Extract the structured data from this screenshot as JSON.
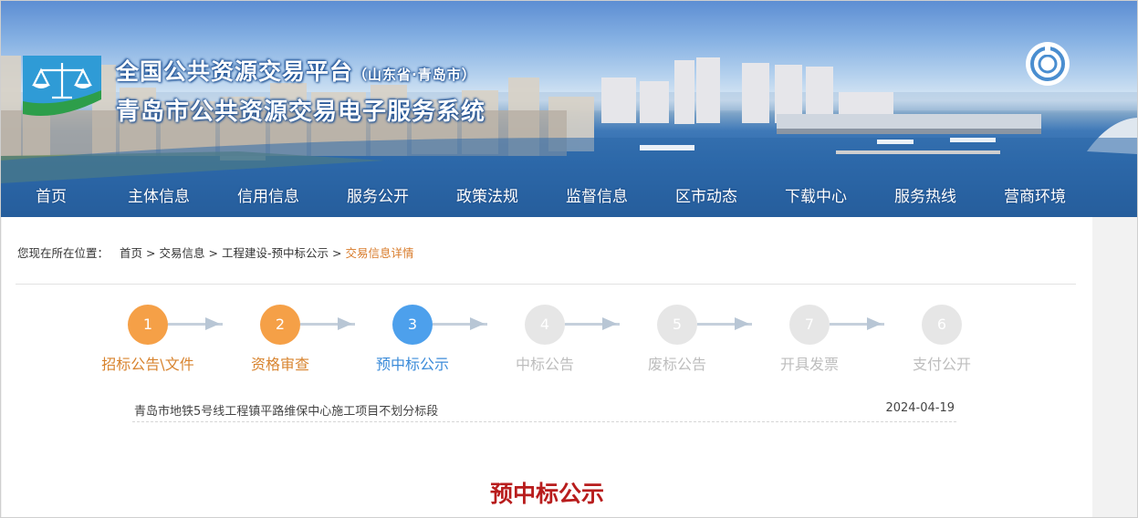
{
  "header": {
    "title_main": "全国公共资源交易平台",
    "title_sub": "（山东省·青岛市）",
    "title_system": "青岛市公共资源交易电子服务系统"
  },
  "nav": [
    "首页",
    "主体信息",
    "信用信息",
    "服务公开",
    "政策法规",
    "监督信息",
    "区市动态",
    "下载中心",
    "服务热线",
    "营商环境"
  ],
  "breadcrumb": {
    "prefix": "您现在所在位置：",
    "items": [
      "首页",
      "交易信息",
      "工程建设-预中标公示"
    ],
    "current": "交易信息详情"
  },
  "steps": [
    {
      "num": "1",
      "label": "招标公告\\文件",
      "state": "done"
    },
    {
      "num": "2",
      "label": "资格审查",
      "state": "done"
    },
    {
      "num": "3",
      "label": "预中标公示",
      "state": "active"
    },
    {
      "num": "4",
      "label": "中标公告",
      "state": "pending"
    },
    {
      "num": "5",
      "label": "废标公告",
      "state": "pending"
    },
    {
      "num": "7",
      "label": "开具发票",
      "state": "pending"
    },
    {
      "num": "6",
      "label": "支付公开",
      "state": "pending"
    }
  ],
  "project": {
    "name": "青岛市地铁5号线工程镇平路维保中心施工项目不划分标段",
    "date": "2024-04-19"
  },
  "page_heading": "预中标公示",
  "icons": {
    "logo": "scales-of-justice-logo",
    "power": "power-icon"
  },
  "colors": {
    "done": "#f5a047",
    "active": "#4da0ec",
    "pending": "#e6e6e6",
    "heading": "#b81d1d",
    "breadcrumb_current": "#d87b2a"
  }
}
